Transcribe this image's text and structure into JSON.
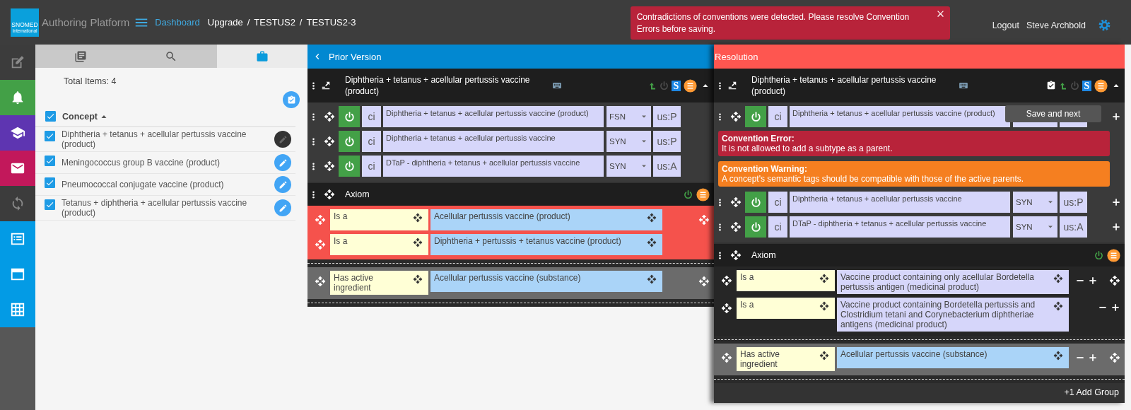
{
  "header": {
    "logo": {
      "wordmark": "SNOMED",
      "tagline": "International"
    },
    "brand": "Authoring Platform",
    "nav_link": "Dashboard",
    "breadcrumb": [
      "Upgrade",
      "TESTUS2",
      "TESTUS2-3"
    ],
    "separator": "/",
    "alert": {
      "message": "Contradictions of conventions were detected. Please resolve Convention Errors before saving."
    },
    "user_links": [
      "Logout",
      "Steve Archbold"
    ]
  },
  "rail": [
    {
      "color": "#3c3c3c",
      "disabled": true
    },
    {
      "color": "#43a047",
      "disabled": false
    },
    {
      "color": "#5e35b1",
      "disabled": false
    },
    {
      "color": "#c2185b",
      "disabled": false
    },
    {
      "color": "#3c3c3c",
      "disabled": true
    },
    {
      "color": "#039be5",
      "disabled": false
    },
    {
      "color": "#039be5",
      "disabled": false
    },
    {
      "color": "#039be5",
      "disabled": false
    }
  ],
  "list_panel": {
    "tabs": [
      {
        "selected": false
      },
      {
        "selected": false
      },
      {
        "selected": true
      }
    ],
    "total": "Total Items: 4",
    "header": {
      "label": "Concept",
      "checked": true
    },
    "items": [
      {
        "label": "Diphtheria + tetanus + acellular pertussis vaccine (product)",
        "checked": true,
        "selected": true
      },
      {
        "label": "Meningococcus group B vaccine (product)",
        "checked": true,
        "selected": false
      },
      {
        "label": "Pneumococcal conjugate vaccine (product)",
        "checked": true,
        "selected": false
      },
      {
        "label": "Tetanus + diphtheria + acellular pertussis vaccine (product)",
        "checked": true,
        "selected": false
      }
    ]
  },
  "prior_panel": {
    "title": "Prior Version",
    "back_button": true,
    "color": "#0288d1",
    "editable": false,
    "concept": {
      "title": "Diphtheria + tetanus + acellular pertussis vaccine (product)",
      "badge": "S",
      "save_button": false
    },
    "descriptions": [
      {
        "active": true,
        "case": "ci",
        "term": "Diphtheria + tetanus + acellular pertussis vaccine (product)",
        "type": "FSN",
        "acceptability": "us:P"
      },
      {
        "active": true,
        "case": "ci",
        "term": "Diphtheria + tetanus + acellular pertussis vaccine",
        "type": "SYN",
        "acceptability": "us:P"
      },
      {
        "active": true,
        "case": "ci",
        "term": "DTaP - diphtheria + tetanus + acellular pertussis vaccine",
        "type": "SYN",
        "acceptability": "us:A"
      }
    ],
    "axiom": {
      "label": "Axiom",
      "groups": [
        {
          "color": "#f5524c",
          "relationships": [
            {
              "type": "Is a",
              "target": "Acellular pertussis vaccine (product)",
              "color": "#aad4f8"
            },
            {
              "type": "Is a",
              "target": "Diphtheria + pertussis + tetanus vaccine (product)",
              "color": "#aad4f8"
            }
          ]
        },
        {
          "color": "#6b6b6b",
          "relationships": [
            {
              "type": "Has active ingredient",
              "target": "Acellular pertussis vaccine (substance)",
              "color": "#aad4f8"
            }
          ]
        }
      ]
    }
  },
  "resolution_panel": {
    "title": "Resolution",
    "back_button": false,
    "color": "#fe5650",
    "editable": true,
    "concept": {
      "title": "Diphtheria + tetanus + acellular pertussis vaccine (product)",
      "badge": "S",
      "save_button": true
    },
    "tooltip": "Save and next",
    "descriptions": [
      {
        "active": true,
        "case": "ci",
        "term": "Diphtheria + tetanus + acellular pertussis vaccine (product)",
        "messages": [
          {
            "kind": "error",
            "title": "Convention Error:",
            "text": "It is not allowed to add a subtype as a parent."
          },
          {
            "kind": "warning",
            "title": "Convention Warning:",
            "text": "A concept's semantic tags should be compatible with those of the active parents."
          }
        ]
      },
      {
        "active": true,
        "case": "ci",
        "term": "Diphtheria + tetanus + acellular pertussis vaccine",
        "type": "SYN",
        "acceptability": "us:P"
      },
      {
        "active": true,
        "case": "ci",
        "term": "DTaP - diphtheria + tetanus + acellular pertussis vaccine",
        "type": "SYN",
        "acceptability": "us:A"
      }
    ],
    "axiom": {
      "label": "Axiom",
      "groups": [
        {
          "color": "#262626",
          "relationships": [
            {
              "type": "Is a",
              "target": "Vaccine product containing only acellular Bordetella pertussis antigen (medicinal product)",
              "color": "#d6d6fa"
            },
            {
              "type": "Is a",
              "target": "Vaccine product containing Bordetella pertussis and Clostridium tetani and Corynebacterium diphtheriae antigens (medicinal product)",
              "color": "#d6d6fa"
            }
          ]
        },
        {
          "color": "#6b6b6b",
          "relationships": [
            {
              "type": "Has active ingredient",
              "target": "Acellular pertussis vaccine (substance)",
              "color": "#aad4f8"
            }
          ]
        }
      ]
    },
    "add_group": "+1 Add Group"
  }
}
